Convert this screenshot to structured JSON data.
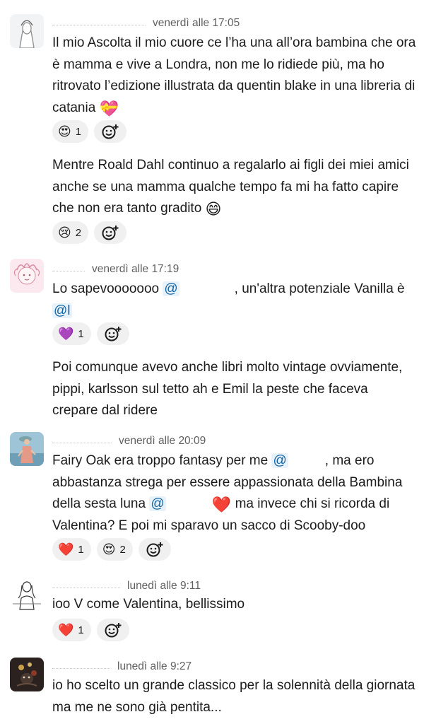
{
  "messages": [
    {
      "timestamp": "venerdì alle 17:05",
      "paragraphs": [
        {
          "text": "Il mio Ascolta il mio cuore ce l’ha una all’ora bambina che ora è mamma e vive a Londra, non me lo ridiede più, ma ho ritrovato l’edizione illustrata da quentin blake in una libreria di catania",
          "emoji": "💝",
          "reactions": [
            {
              "emoji": "😍",
              "count": "1"
            }
          ]
        },
        {
          "text": "Mentre Roald Dahl continuo a regalarlo ai figli dei miei amici anche se una mamma qualche tempo fa mi ha fatto capire che non era tanto gradito",
          "emoji": "😄",
          "reactions": [
            {
              "emoji": "😢",
              "count": "2"
            }
          ]
        }
      ]
    },
    {
      "timestamp": "venerdì alle 17:19",
      "paragraphs": [
        {
          "text_a": "Lo sapevooooooo",
          "mention_a": "@",
          "text_b": ", un'altra potenziale Vanilla è",
          "mention_b": "@l",
          "reactions": [
            {
              "emoji": "💜",
              "count": "1"
            }
          ]
        },
        {
          "text": "Poi comunque avevo anche libri molto vintage ovviamente, pippi, karlsson sul tetto ah e Emil la peste che faceva crepare dal ridere"
        }
      ]
    },
    {
      "timestamp": "venerdì alle 20:09",
      "paragraphs": [
        {
          "text_a": "Fairy Oak era troppo fantasy per me",
          "mention_a": "@",
          "text_b": ", ma ero abbastanza strega per essere appassionata della Bambina della sesta luna",
          "mention_b": "@",
          "emoji": "❤️",
          "text_c": "ma invece chi si ricorda di Valentina? E poi mi sparavo un sacco di Scooby-doo",
          "reactions": [
            {
              "emoji": "❤️",
              "count": "1"
            },
            {
              "emoji": "😍",
              "count": "2"
            }
          ]
        }
      ]
    },
    {
      "timestamp": "lunedì alle 9:11",
      "paragraphs": [
        {
          "text": "ioo V come Valentina, bellissimo",
          "reactions": [
            {
              "emoji": "❤️",
              "count": "1"
            }
          ]
        }
      ]
    },
    {
      "timestamp": "lunedì alle 9:27",
      "paragraphs": [
        {
          "text": "io ho scelto un grande classico per la solennità della giornata ma me ne sono già pentita..."
        }
      ]
    }
  ],
  "icons": {
    "add_reaction": "add-reaction-icon"
  }
}
